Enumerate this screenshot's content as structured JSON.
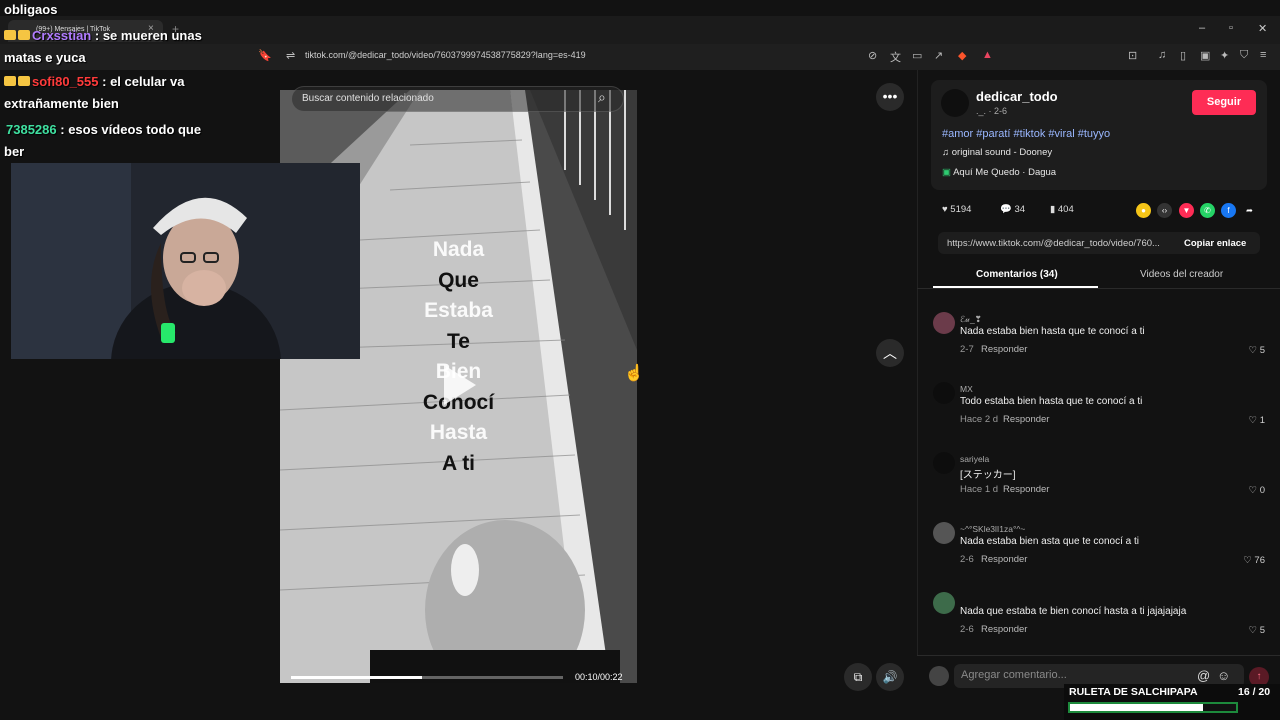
{
  "browser": {
    "tab_title": "(99+) Mensajes | TikTok",
    "url": "tiktok.com/@dedicar_todo/video/7603799974538775829?lang=es-419"
  },
  "video": {
    "search_placeholder": "Buscar contenido relacionado",
    "overlay_words": [
      {
        "text": "Nada",
        "style": "light"
      },
      {
        "text": "Que",
        "style": "dark"
      },
      {
        "text": "Estaba",
        "style": "light"
      },
      {
        "text": "Te",
        "style": "dark"
      },
      {
        "text": "Bien",
        "style": "light"
      },
      {
        "text": "Conocí",
        "style": "dark"
      },
      {
        "text": "Hasta",
        "style": "light"
      },
      {
        "text": "A ti",
        "style": "dark"
      }
    ],
    "time": "00:10/00:22",
    "progress": 0.48
  },
  "post": {
    "author": "dedicar_todo",
    "date": "._. · 2-6",
    "follow_label": "Seguir",
    "hashtags": "#amor #paratí #tiktok #viral #tuyyo",
    "sound": "original sound - Dooney",
    "song": "Aquí Me Quedo · Dagua",
    "likes": "5194",
    "comments": "34",
    "saves": "404",
    "link": "https://www.tiktok.com/@dedicar_todo/video/760...",
    "copy_link_label": "Copiar enlace",
    "tab_comments": "Comentarios (34)",
    "tab_videos": "Videos del creador"
  },
  "comments": [
    {
      "user": "ℰ𝓊_❣",
      "text": "Nada estaba bien hasta que te conocí a ti",
      "time": "2-7",
      "reply": "Responder",
      "likes": "5"
    },
    {
      "user": "MX",
      "text": "Todo estaba bien hasta que te conocí a ti",
      "time": "Hace 2 d",
      "reply": "Responder",
      "likes": "1"
    },
    {
      "user": "sariyela",
      "text": "[ステッカー]",
      "time": "Hace 1 d",
      "reply": "Responder",
      "likes": "0"
    },
    {
      "user": "~^°SKle3lI1za°^~",
      "text": "Nada estaba bien asta que te conocí a ti",
      "time": "2-6",
      "reply": "Responder",
      "likes": "76"
    },
    {
      "user": "",
      "text": "Nada que estaba te bien conocí hasta a ti jajajajaja",
      "time": "2-6",
      "reply": "Responder",
      "likes": "5"
    }
  ],
  "comment_input_placeholder": "Agregar comentario...",
  "chat": [
    {
      "user": "",
      "message": "obligaos",
      "user_color": "#ffffff"
    },
    {
      "user": "Crxsstian",
      "message": ": se mueren unas",
      "user_color": "#b07cff"
    },
    {
      "user": "",
      "message": "matas e yuca",
      "user_color": "#ffffff"
    },
    {
      "user": "sofi80_555",
      "message": ": el celular va",
      "user_color": "#ff3b3b"
    },
    {
      "user": "",
      "message": "extrañamente bien",
      "user_color": "#ffffff"
    },
    {
      "user": "7385286",
      "message": ": esos vídeos todo que",
      "user_color": "#3fe0a0"
    },
    {
      "user": "",
      "message": "ber",
      "user_color": "#ffffff"
    }
  ],
  "roulette": {
    "label": "RULETA DE SALCHIPAPA",
    "count": "16  / 20",
    "fill": 0.8
  }
}
